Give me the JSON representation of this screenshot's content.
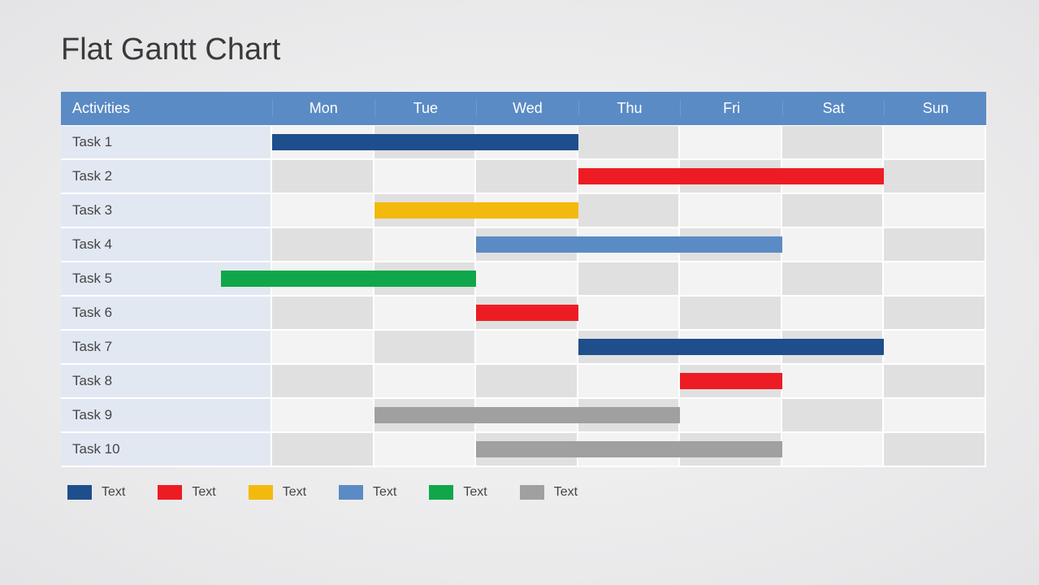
{
  "title": "Flat Gantt Chart",
  "header": {
    "activities_label": "Activities",
    "days": [
      "Mon",
      "Tue",
      "Wed",
      "Thu",
      "Fri",
      "Sat",
      "Sun"
    ]
  },
  "colors": {
    "darkblue": "#1e4e8c",
    "red": "#ed1c24",
    "yellow": "#f3b90d",
    "blue": "#5b8bc5",
    "green": "#0fa74a",
    "gray": "#a0a0a0"
  },
  "tasks": [
    {
      "name": "Task 1",
      "start": 0,
      "span": 3,
      "color": "darkblue"
    },
    {
      "name": "Task 2",
      "start": 3,
      "span": 3,
      "color": "red"
    },
    {
      "name": "Task 3",
      "start": 1,
      "span": 2,
      "color": "yellow"
    },
    {
      "name": "Task 4",
      "start": 2,
      "span": 3,
      "color": "blue"
    },
    {
      "name": "Task 5",
      "start": -0.5,
      "span": 2.5,
      "color": "green"
    },
    {
      "name": "Task 6",
      "start": 2,
      "span": 1,
      "color": "red"
    },
    {
      "name": "Task 7",
      "start": 3,
      "span": 3,
      "color": "darkblue"
    },
    {
      "name": "Task 8",
      "start": 4,
      "span": 1,
      "color": "red"
    },
    {
      "name": "Task 9",
      "start": 1,
      "span": 3,
      "color": "gray"
    },
    {
      "name": "Task 10",
      "start": 2,
      "span": 3,
      "color": "gray"
    }
  ],
  "legend": [
    {
      "color": "darkblue",
      "label": "Text"
    },
    {
      "color": "red",
      "label": "Text"
    },
    {
      "color": "yellow",
      "label": "Text"
    },
    {
      "color": "blue",
      "label": "Text"
    },
    {
      "color": "green",
      "label": "Text"
    },
    {
      "color": "gray",
      "label": "Text"
    }
  ],
  "chart_data": {
    "type": "gantt",
    "title": "Flat Gantt Chart",
    "categories": [
      "Mon",
      "Tue",
      "Wed",
      "Thu",
      "Fri",
      "Sat",
      "Sun"
    ],
    "series": [
      {
        "name": "Task 1",
        "start": "Mon",
        "end": "Wed",
        "color": "#1e4e8c"
      },
      {
        "name": "Task 2",
        "start": "Thu",
        "end": "Sat",
        "color": "#ed1c24"
      },
      {
        "name": "Task 3",
        "start": "Tue",
        "end": "Wed",
        "color": "#f3b90d"
      },
      {
        "name": "Task 4",
        "start": "Wed",
        "end": "Fri",
        "color": "#5b8bc5"
      },
      {
        "name": "Task 5",
        "start": "Mon",
        "end": "Tue",
        "color": "#0fa74a"
      },
      {
        "name": "Task 6",
        "start": "Wed",
        "end": "Wed",
        "color": "#ed1c24"
      },
      {
        "name": "Task 7",
        "start": "Thu",
        "end": "Sat",
        "color": "#1e4e8c"
      },
      {
        "name": "Task 8",
        "start": "Fri",
        "end": "Fri",
        "color": "#ed1c24"
      },
      {
        "name": "Task 9",
        "start": "Tue",
        "end": "Thu",
        "color": "#a0a0a0"
      },
      {
        "name": "Task 10",
        "start": "Wed",
        "end": "Fri",
        "color": "#a0a0a0"
      }
    ],
    "legend": [
      "Text",
      "Text",
      "Text",
      "Text",
      "Text",
      "Text"
    ]
  }
}
